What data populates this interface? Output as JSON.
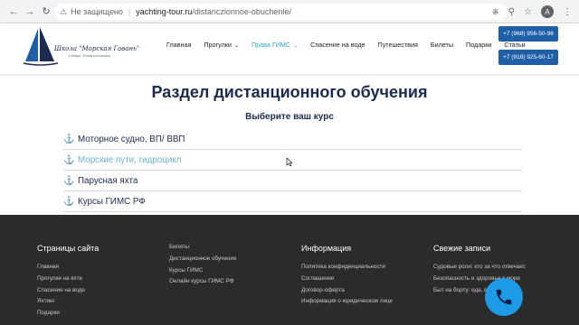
{
  "browser": {
    "insecure_label": "Не защищено",
    "url_domain": "yachting-tour.ru",
    "url_path": "/distanczionnoe-obuchenie/",
    "avatar_letter": "A"
  },
  "header": {
    "logo_title": "Школа \"Морская Гавань\"",
    "logo_subtitle": "Север. Удовольствие",
    "nav": [
      {
        "label": "Главная"
      },
      {
        "label": "Прогулки",
        "has_dropdown": true
      },
      {
        "label": "Права ГИМС",
        "has_dropdown": true,
        "active": true
      },
      {
        "label": "Спасение на воде"
      },
      {
        "label": "Путешествия"
      },
      {
        "label": "Билеты"
      },
      {
        "label": "Подарки"
      },
      {
        "label": "Статьи"
      }
    ],
    "phone_1": "+7 (968) 956-50-96",
    "phone_2": "+7 (916) 925-60-17"
  },
  "main": {
    "title": "Раздел дистанционного обучения",
    "subtitle": "Выберите ваш курс",
    "courses": [
      {
        "label": "Моторное судно, ВП/ ВВП"
      },
      {
        "label": "Морские пути, гидроцикл",
        "hover": true
      },
      {
        "label": "Парусная яхта"
      },
      {
        "label": "Курсы ГИМС РФ"
      }
    ]
  },
  "footer": {
    "col1": {
      "heading": "Страницы сайта",
      "links": [
        "Главная",
        "Прогулки на яхте",
        "Спасение на воде",
        "Яхтинг",
        "Подарки"
      ]
    },
    "col2": {
      "links": [
        "Билеты",
        "Дистанционное обучение",
        "Курсы ГИМС",
        "Онлайн курсы ГИМС РФ"
      ]
    },
    "col3": {
      "heading": "Информация",
      "links": [
        "Политика конфиденциальности",
        "Соглашение",
        "Договор-оферта",
        "Информация о юридическом лице"
      ]
    },
    "col4": {
      "heading": "Свежие записи",
      "links": [
        "Судовые роли: кто за что отвечает.",
        "Безопасность и здоровье в море",
        "Быт на борту: еда, вода"
      ]
    }
  },
  "colors": {
    "brand_navy": "#1b2a4e",
    "accent_blue": "#1f5fa8",
    "active_link": "#30a0c8",
    "footer_bg": "#2b2b2b",
    "call_button": "#1e9be6"
  }
}
